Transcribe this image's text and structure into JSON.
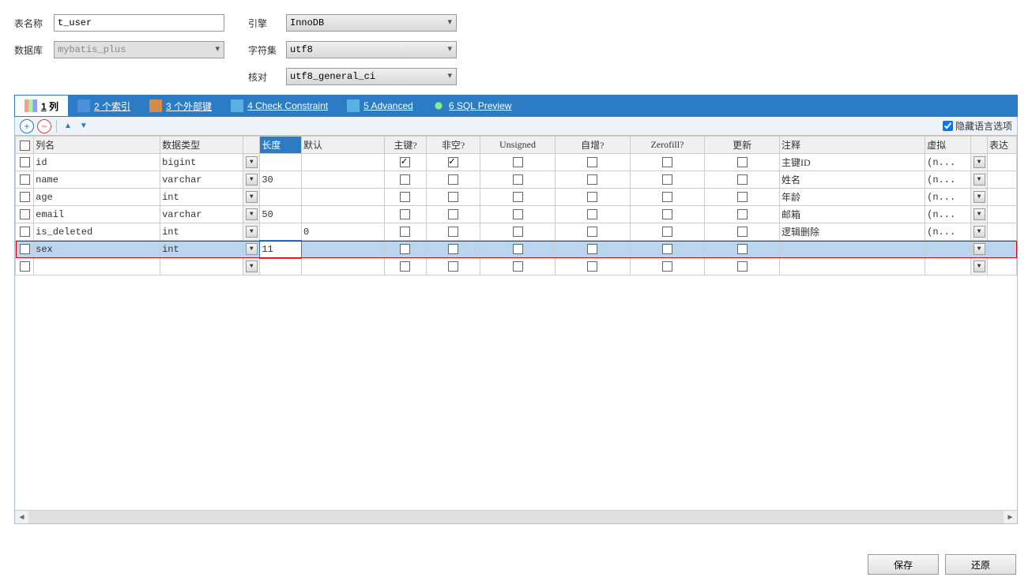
{
  "form": {
    "table_name_label": "表名称",
    "table_name_value": "t_user",
    "database_label": "数据库",
    "database_value": "mybatis_plus",
    "engine_label": "引擎",
    "engine_value": "InnoDB",
    "charset_label": "字符集",
    "charset_value": "utf8",
    "collation_label": "核对",
    "collation_value": "utf8_general_ci"
  },
  "tabs": {
    "columns": "1 列",
    "indexes": "2 个索引",
    "fks": "3 个外部键",
    "check": "4 Check Constraint",
    "advanced": "5 Advanced",
    "sql": "6 SQL Preview"
  },
  "hide_lang_label": "隐藏语言选项",
  "headers": {
    "col_name": "列名",
    "data_type": "数据类型",
    "length": "长度",
    "default": "默认",
    "pk": "主键?",
    "not_null": "非空?",
    "unsigned": "Unsigned",
    "auto_inc": "自增?",
    "zerofill": "Zerofill?",
    "on_update": "更新",
    "comment": "注释",
    "virtual": "虚拟",
    "expr": "表达"
  },
  "rows": [
    {
      "name": "id",
      "type": "bigint",
      "len": "",
      "def": "",
      "pk": true,
      "nn": true,
      "us": false,
      "ai": false,
      "zf": false,
      "upd": false,
      "cmt": "主键ID",
      "virt": "(n..."
    },
    {
      "name": "name",
      "type": "varchar",
      "len": "30",
      "def": "",
      "pk": false,
      "nn": false,
      "us": false,
      "ai": false,
      "zf": false,
      "upd": false,
      "cmt": "姓名",
      "virt": "(n..."
    },
    {
      "name": "age",
      "type": "int",
      "len": "",
      "def": "",
      "pk": false,
      "nn": false,
      "us": false,
      "ai": false,
      "zf": false,
      "upd": false,
      "cmt": "年龄",
      "virt": "(n..."
    },
    {
      "name": "email",
      "type": "varchar",
      "len": "50",
      "def": "",
      "pk": false,
      "nn": false,
      "us": false,
      "ai": false,
      "zf": false,
      "upd": false,
      "cmt": "邮箱",
      "virt": "(n..."
    },
    {
      "name": "is_deleted",
      "type": "int",
      "len": "",
      "def": "0",
      "pk": false,
      "nn": false,
      "us": false,
      "ai": false,
      "zf": false,
      "upd": false,
      "cmt": "逻辑删除",
      "virt": "(n..."
    },
    {
      "name": "sex",
      "type": "int",
      "len": "11",
      "def": "",
      "pk": false,
      "nn": false,
      "us": false,
      "ai": false,
      "zf": false,
      "upd": false,
      "cmt": "",
      "virt": "",
      "selected": true
    },
    {
      "name": "",
      "type": "",
      "len": "",
      "def": "",
      "pk": false,
      "nn": false,
      "us": false,
      "ai": false,
      "zf": false,
      "upd": false,
      "cmt": "",
      "virt": ""
    }
  ],
  "buttons": {
    "save": "保存",
    "revert": "还原"
  }
}
